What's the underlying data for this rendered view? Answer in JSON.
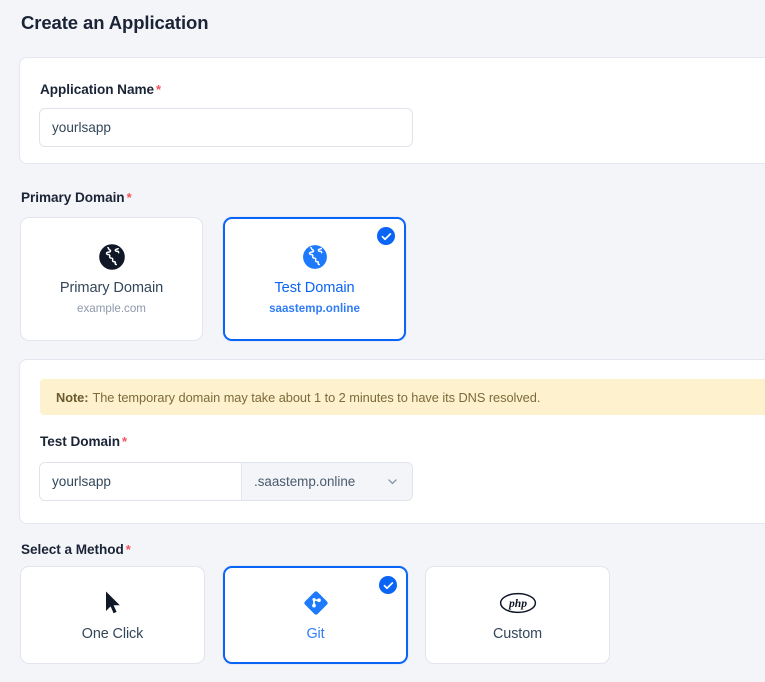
{
  "page": {
    "title": "Create an Application",
    "required_marker": "*"
  },
  "application_name": {
    "label": "Application Name",
    "value": "yourlsapp",
    "placeholder": "yourlsapp"
  },
  "primary_domain": {
    "label": "Primary Domain",
    "options": [
      {
        "title": "Primary Domain",
        "subtitle": "example.com",
        "icon": "globe-icon",
        "selected": false
      },
      {
        "title": "Test Domain",
        "subtitle": "saastemp.online",
        "icon": "globe-icon",
        "selected": true
      }
    ]
  },
  "note": {
    "strong": "Note:",
    "text": "The temporary domain may take about 1 to 2 minutes to have its DNS resolved."
  },
  "test_domain": {
    "label": "Test Domain",
    "value": "yourlsapp",
    "placeholder": "yourlsapp",
    "suffix": ".saastemp.online",
    "suffix_options": [
      ".saastemp.online"
    ]
  },
  "method": {
    "label": "Select a Method",
    "options": [
      {
        "label": "One Click",
        "icon": "cursor-icon",
        "selected": false
      },
      {
        "label": "Git",
        "icon": "git-icon",
        "selected": true
      },
      {
        "label": "Custom",
        "icon": "php-icon",
        "selected": false
      }
    ]
  },
  "colors": {
    "accent": "#0a64f5",
    "required": "#f2545b",
    "note_bg": "#fdf2cd",
    "note_text": "#7d6a3c",
    "page_bg": "#f4f5f9",
    "panel_bg": "#ffffff",
    "border": "#e2e5ed"
  }
}
